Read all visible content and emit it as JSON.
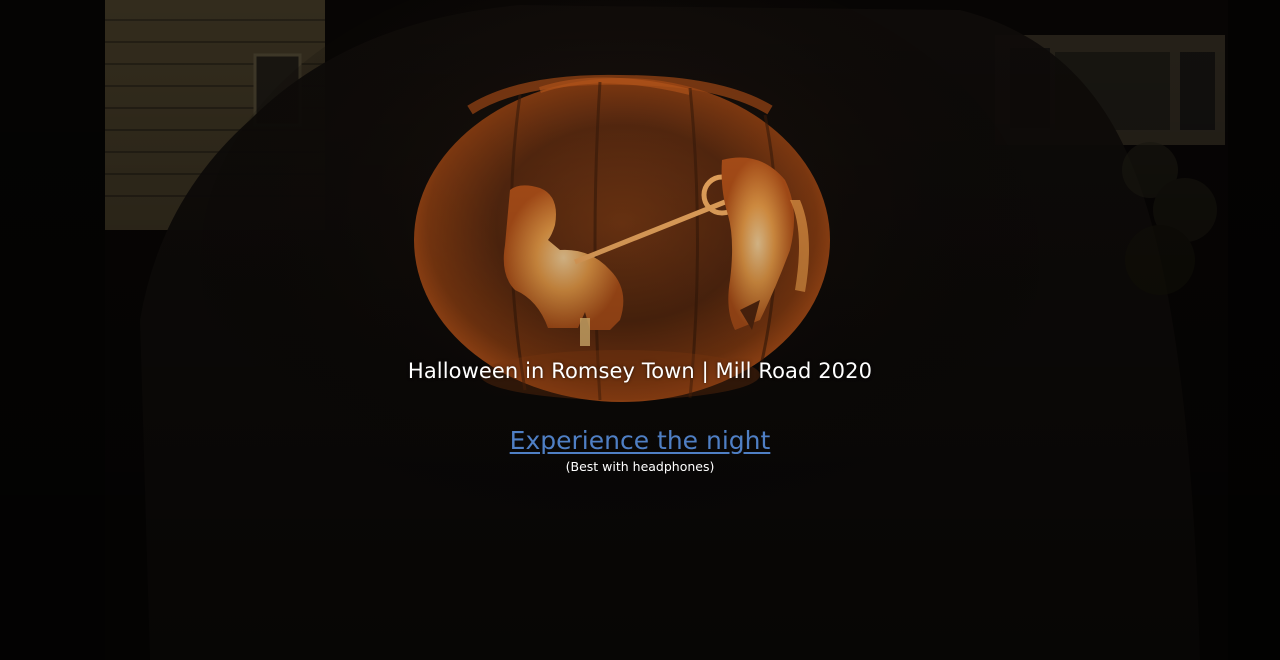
{
  "page": {
    "title": "Halloween in Romsey Town | Mill Road 2020",
    "cta_link": "Experience the night",
    "cta_note": "(Best with headphones)"
  },
  "colors": {
    "link": "#4f7fc4",
    "text": "#ffffff",
    "background": "#050403",
    "pumpkin_glow": "#d9641c"
  },
  "background_image": {
    "subject": "carved jack-o'-lantern pumpkin at night",
    "icon": "pumpkin-icon"
  }
}
